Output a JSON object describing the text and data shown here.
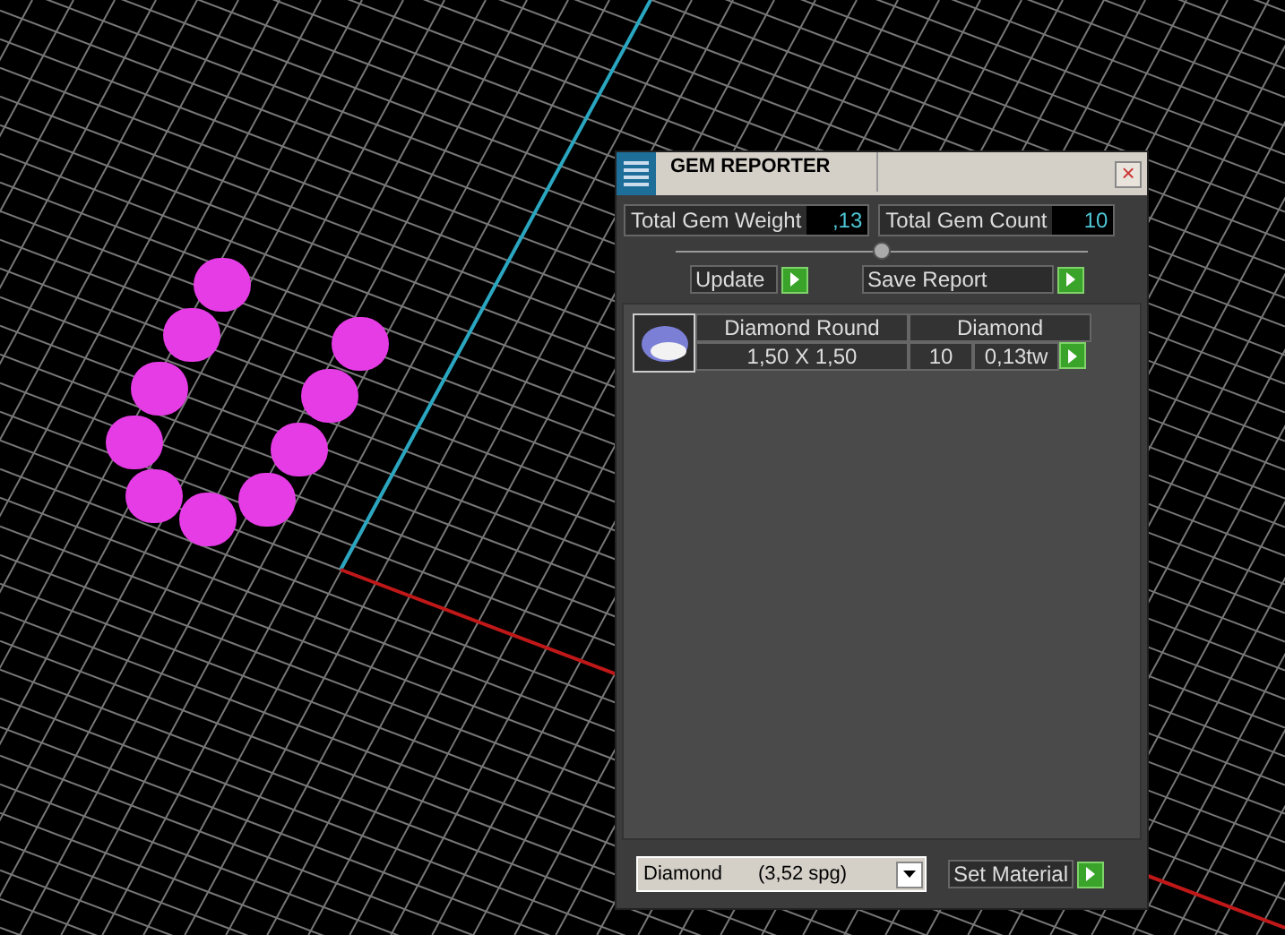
{
  "window": {
    "title": "GEM REPORTER",
    "close": "×"
  },
  "totals": [
    {
      "label": "Total Gem Weight",
      "value": ",13"
    },
    {
      "label": "Total Gem Count",
      "value": "10"
    }
  ],
  "actions": [
    {
      "label": "Update"
    },
    {
      "label": "Save Report"
    }
  ],
  "gems": [
    {
      "name": "Diamond Round",
      "material": "Diamond",
      "size": "1,50 X 1,50",
      "count": "10",
      "weight": "0,13tw"
    }
  ],
  "material_select": {
    "value": "Diamond",
    "density": "(3,52 spg)"
  },
  "set_button": {
    "label": "Set Material"
  }
}
